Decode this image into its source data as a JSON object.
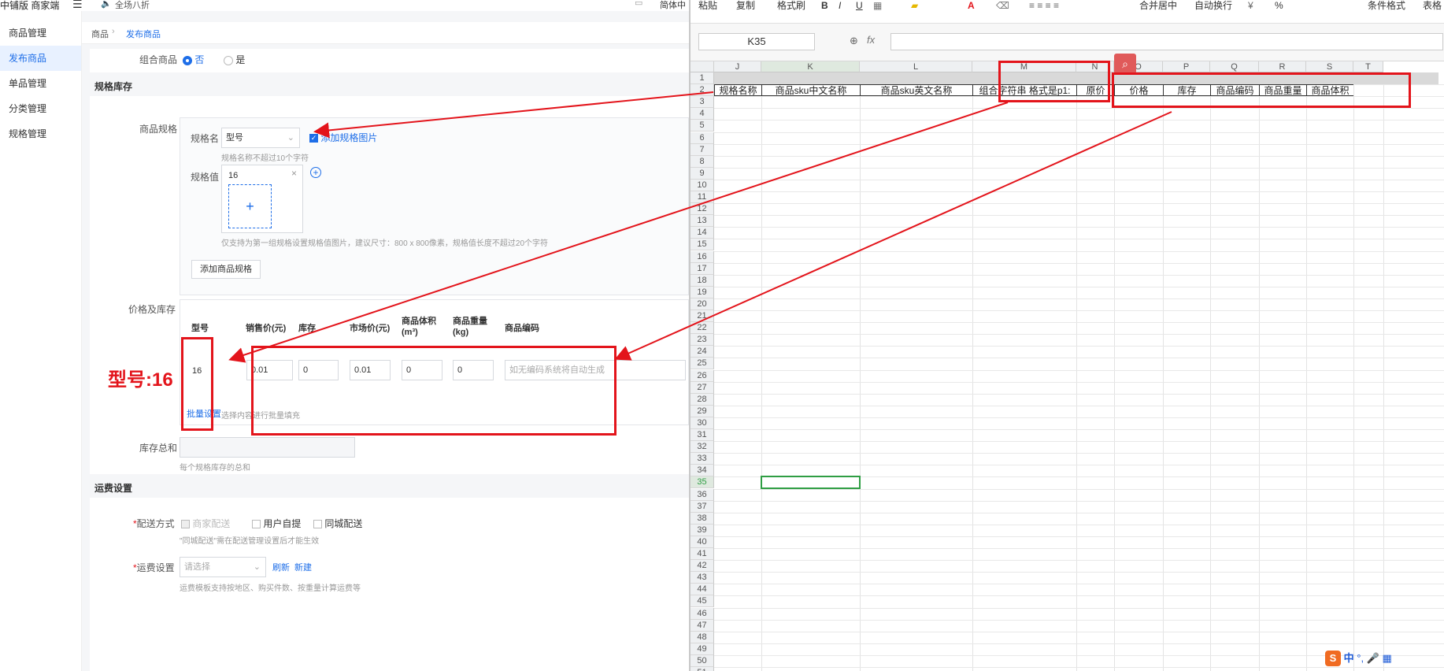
{
  "app": {
    "brand": "中铺版 商家端",
    "promo": "全场八折",
    "lang": "简体中"
  },
  "sidebar": {
    "items": [
      {
        "label": "商品管理"
      },
      {
        "label": "发布商品"
      },
      {
        "label": "单品管理"
      },
      {
        "label": "分类管理"
      },
      {
        "label": "规格管理"
      }
    ]
  },
  "breadcrumb": {
    "root": "商品",
    "current": "发布商品"
  },
  "form": {
    "combo_label": "组合商品",
    "combo_no": "否",
    "combo_yes": "是",
    "spec_section": "规格库存",
    "spec_label": "商品规格",
    "spec_name_label": "规格名",
    "spec_name_value": "型号",
    "add_spec_image": "添加规格图片",
    "spec_name_hint": "规格名称不超过10个字符",
    "spec_value_label": "规格值",
    "spec_value": "16",
    "spec_value_hint": "仅支持为第一组规格设置规格值图片，建议尺寸：800 x 800像素，规格值长度不超过20个字符",
    "add_spec_button": "添加商品规格",
    "price_label": "价格及库存",
    "table_headers": {
      "model": "型号",
      "sale_price": "销售价(元)",
      "stock": "库存",
      "market_price": "市场价(元)",
      "volume_1": "商品体积",
      "volume_2": "(m³)",
      "weight_1": "商品重量",
      "weight_2": "(kg)",
      "code": "商品编码"
    },
    "row": {
      "model": "16",
      "sale_price": "0.01",
      "stock": "0",
      "market_price": "0.01",
      "volume": "0",
      "weight": "0",
      "code_placeholder": "如无编码系统将自动生成"
    },
    "batch_link": "批量设置",
    "batch_hint": "选择内容进行批量填充",
    "stock_total_label": "库存总和",
    "stock_total_hint": "每个规格库存的总和",
    "shipping_section": "运费设置",
    "delivery_label": "配送方式",
    "delivery_options": [
      "商家配送",
      "用户自提",
      "同城配送"
    ],
    "delivery_hint": "\"同城配送\"需在配送管理设置后才能生效",
    "freight_label": "运费设置",
    "freight_placeholder": "请选择",
    "refresh_link": "刷新",
    "new_link": "新建",
    "freight_hint": "运费模板支持按地区、购买件数、按重量计算运费等",
    "annotation": "型号:16"
  },
  "spreadsheet": {
    "ribbon": [
      "粘贴",
      "复制",
      "格式刷",
      "B",
      "I",
      "U",
      "合并居中",
      "自动换行",
      "%",
      "条件格式",
      "表格"
    ],
    "name_box": "K35",
    "fx": "fx",
    "columns": [
      "J",
      "K",
      "L",
      "M",
      "N",
      "O",
      "P",
      "Q",
      "R",
      "S",
      "T"
    ],
    "header_row": [
      "规格名称",
      "商品sku中文名称",
      "商品sku英文名称",
      "组合字符串 格式是p1:",
      "原价",
      "价格",
      "库存",
      "商品编码",
      "商品重量",
      "商品体积"
    ],
    "row_count": 51,
    "selected_cell_row": 35,
    "ime": [
      "中",
      "°,"
    ]
  },
  "colors": {
    "accent": "#1e6ee8",
    "annotation_red": "#e3141b",
    "selection_green": "#2f9e44"
  }
}
